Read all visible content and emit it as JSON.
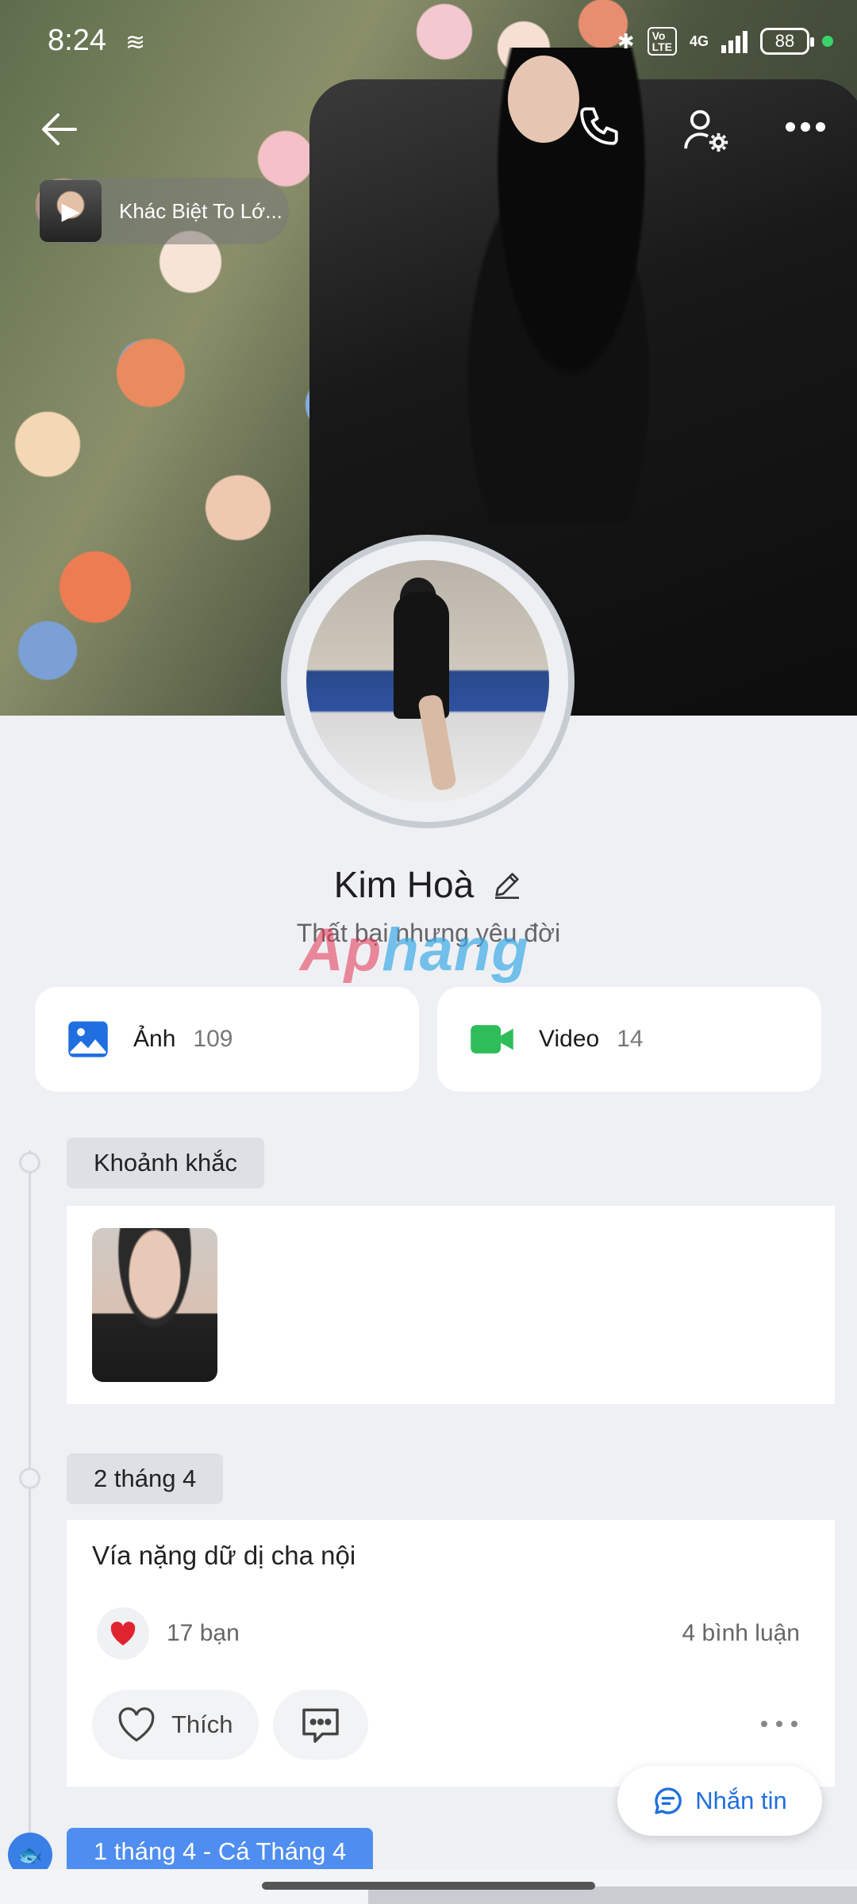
{
  "status_bar": {
    "time": "8:24",
    "network": "4G",
    "battery": "88"
  },
  "cover": {
    "music_title": "Khác Biệt To Lớ..."
  },
  "profile": {
    "name": "Kim Hoà",
    "bio": "Thất bại nhưng yêu đời"
  },
  "media": {
    "photos_label": "Ảnh",
    "photos_count": "109",
    "videos_label": "Video",
    "videos_count": "14"
  },
  "timeline": {
    "moments_label": "Khoảnh khắc",
    "post_date": "2 tháng 4",
    "post_text": "Vía nặng dữ dị cha nội",
    "reaction_count": "17 bạn",
    "comments_count": "4 bình luận",
    "like_label": "Thích",
    "next_date": "1 tháng 4 - Cá Tháng 4"
  },
  "actions": {
    "message_label": "Nhắn tin"
  },
  "watermark": {
    "part1": "Ap",
    "part2": "hang"
  },
  "colors": {
    "accent": "#1f6fe0",
    "photo_icon": "#1f6fe0",
    "video_icon": "#2ebd59",
    "heart": "#e0242f"
  },
  "icons": {
    "back": "arrow-left-icon",
    "call": "phone-icon",
    "settings": "user-settings-icon",
    "more": "more-dots-icon",
    "play": "play-icon",
    "edit": "pencil-icon",
    "photos": "image-icon",
    "videos": "video-camera-icon",
    "heart": "heart-icon",
    "like": "heart-outline-icon",
    "comment": "comment-icon",
    "message": "chat-bubble-icon"
  }
}
